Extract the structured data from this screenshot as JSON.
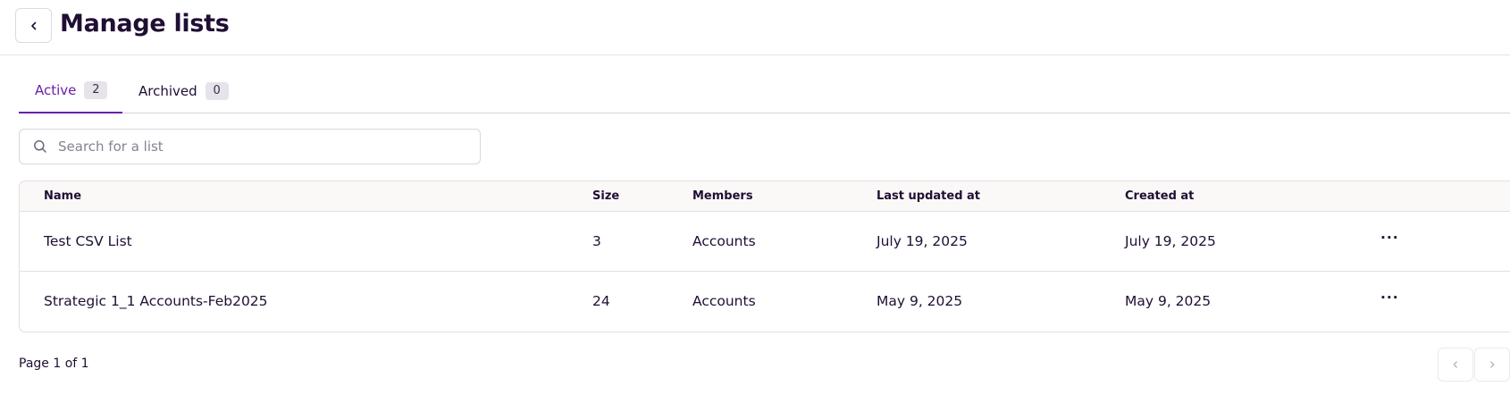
{
  "header": {
    "title": "Manage lists",
    "back_icon": "chevron-left-icon"
  },
  "tabs": [
    {
      "label": "Active",
      "count": "2"
    },
    {
      "label": "Archived",
      "count": "0"
    }
  ],
  "search": {
    "placeholder": "Search for a list",
    "value": "",
    "icon": "search-icon"
  },
  "table": {
    "columns": [
      "Name",
      "Size",
      "Members",
      "Last updated at",
      "Created at"
    ],
    "rows": [
      {
        "name": "Test CSV List",
        "size": "3",
        "members": "Accounts",
        "updated": "July 19, 2025",
        "created": "July 19, 2025",
        "more": "···"
      },
      {
        "name": "Strategic 1_1 Accounts-Feb2025",
        "size": "24",
        "members": "Accounts",
        "updated": "May 9, 2025",
        "created": "May 9, 2025",
        "more": "···"
      }
    ]
  },
  "pagination": {
    "text": "Page 1 of 1"
  },
  "colors": {
    "accent": "#6b1fa8",
    "text": "#1f0f33",
    "border": "#e1dfe4"
  }
}
